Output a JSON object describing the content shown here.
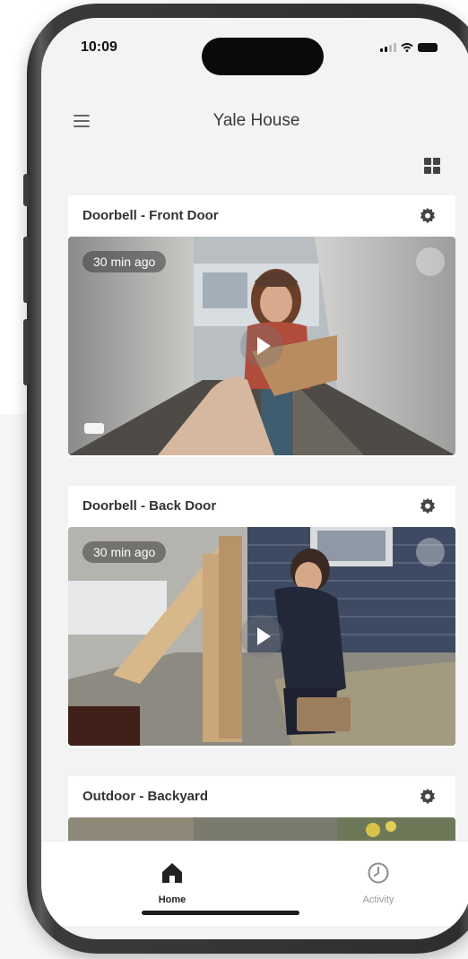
{
  "status_bar": {
    "time": "10:09"
  },
  "header": {
    "title": "Yale House"
  },
  "cameras": [
    {
      "name": "Doorbell - Front Door",
      "time_ago": "30 min ago"
    },
    {
      "name": "Doorbell - Back Door",
      "time_ago": "30 min ago"
    },
    {
      "name": "Outdoor - Backyard"
    }
  ],
  "tabs": [
    {
      "label": "Home",
      "icon": "home-icon",
      "active": true
    },
    {
      "label": "Activity",
      "icon": "clock-icon",
      "active": false
    }
  ],
  "colors": {
    "active_tab": "#222222",
    "inactive_tab": "#9a9a9a",
    "screen_bg": "#f3f3f4"
  }
}
